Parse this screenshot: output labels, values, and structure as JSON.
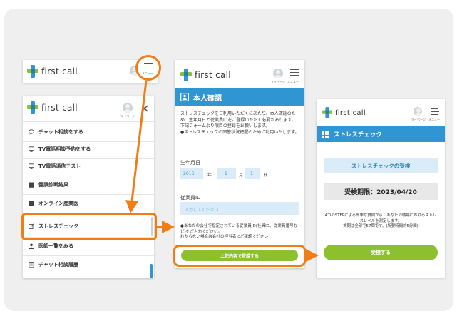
{
  "colors": {
    "accent_orange": "#f07d15",
    "brand_blue": "#2f96d3",
    "brand_green": "#8cc02f"
  },
  "header": {
    "logo_text": "first call",
    "mypage_label": "マイページ",
    "menu_label": "メニュー"
  },
  "menu": {
    "items": [
      {
        "label": "チャット相談をする",
        "icon": "chat-icon"
      },
      {
        "label": "TV電話相談予約をする",
        "icon": "monitor-icon"
      },
      {
        "label": "TV電話通信テスト",
        "icon": "monitor-icon"
      },
      {
        "label": "健康診断結果",
        "icon": "clipboard-icon"
      },
      {
        "label": "オンライン産業医",
        "icon": "clipboard-icon"
      },
      {
        "label": "ストレスチェック",
        "icon": "edit-icon"
      },
      {
        "label": "医師一覧をみる",
        "icon": "doctor-icon"
      },
      {
        "label": "チャット相談履歴",
        "icon": "history-icon"
      }
    ]
  },
  "identity": {
    "title": "本人確認",
    "intro": "ストレスチェックをご利用いただくにあたり、本人確認のため、生年月日と従業員IDをご登録いただく必要があります。\n下記フォームより項目の登録をお願いします。\n●ストレスチェックの回答状況把握のために利用いたします。",
    "dob_label": "生年月日",
    "year_value": "2016",
    "year_unit": "年",
    "month_value": "1",
    "month_unit": "月",
    "day_value": "1",
    "day_unit": "日",
    "empid_label": "従業員ID",
    "empid_placeholder": "入力してください",
    "note": "●あなたの会社で指定されている従業員ID(社員ID、従業員番号など)をご入力ください。\nわからない場合は会社の担当者にご確認ください",
    "submit_label": "上記内容で登録する"
  },
  "stress": {
    "title": "ストレスチェック",
    "exam_title": "ストレスチェックの受検",
    "deadline": "受検期限：2023/04/20",
    "description": "4つのSTEPによる簡単な質問から、あなたの職場におけるストレスレベルを測定します。\n質問は全部で57問です。(所要時間約5分間)",
    "start_label": "受検する"
  }
}
